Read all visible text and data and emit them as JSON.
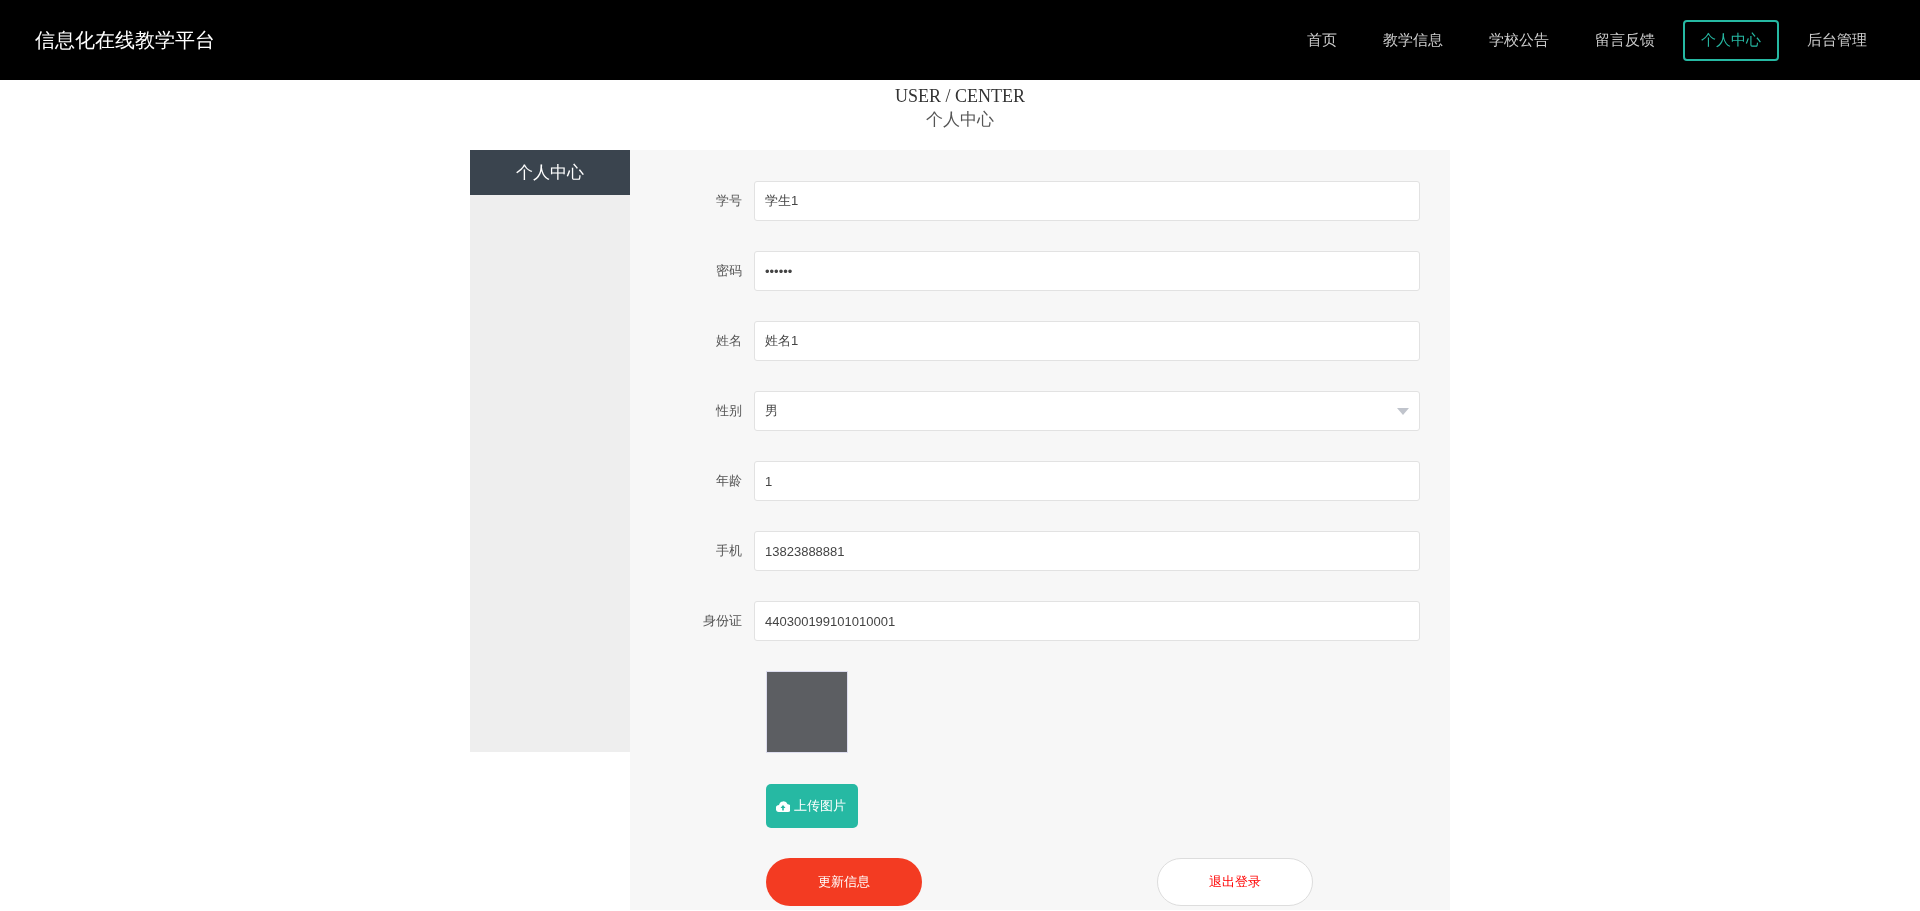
{
  "header": {
    "brand": "信息化在线教学平台",
    "nav": [
      {
        "label": "首页",
        "selected": false
      },
      {
        "label": "教学信息",
        "selected": false
      },
      {
        "label": "学校公告",
        "selected": false
      },
      {
        "label": "留言反馈",
        "selected": false
      },
      {
        "label": "个人中心",
        "selected": true
      },
      {
        "label": "后台管理",
        "selected": false
      }
    ]
  },
  "page_title": {
    "english": "USER / CENTER",
    "chinese": "个人中心"
  },
  "sidebar": {
    "title": "个人中心"
  },
  "form": {
    "fields": [
      {
        "label": "学号",
        "kind": "input",
        "value": "学生1"
      },
      {
        "label": "密码",
        "kind": "input",
        "value": "••••••"
      },
      {
        "label": "姓名",
        "kind": "input",
        "value": "姓名1"
      },
      {
        "label": "性别",
        "kind": "select",
        "value": "男"
      },
      {
        "label": "年龄",
        "kind": "input",
        "value": "1"
      },
      {
        "label": "手机",
        "kind": "input",
        "value": "13823888881"
      },
      {
        "label": "身份证",
        "kind": "input",
        "value": "440300199101010001"
      }
    ],
    "upload_button": "上传图片",
    "update_button": "更新信息",
    "logout_button": "退出登录"
  }
}
